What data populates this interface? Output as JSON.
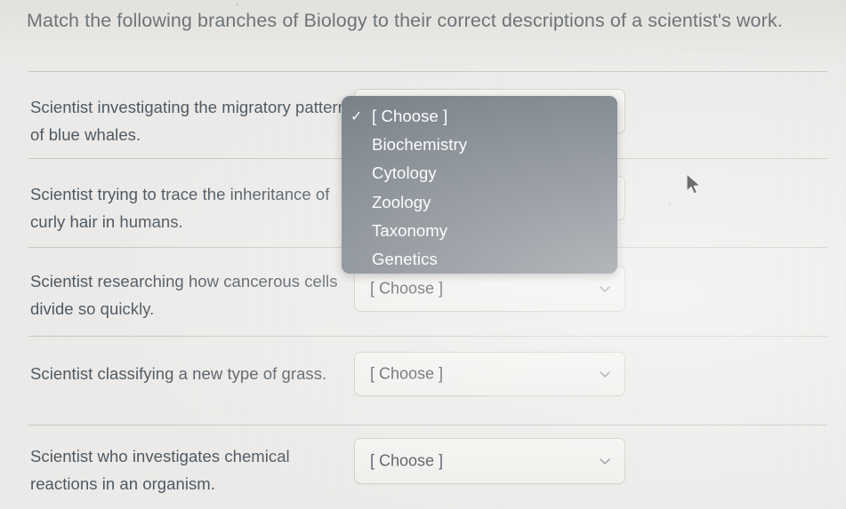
{
  "prompt": {
    "text": "Match the following branches of Biology to their correct descriptions of a scientist's work."
  },
  "colors": {
    "page_background": "#edecea",
    "text": "#4e5862",
    "dropdown_background": "#767e86",
    "dropdown_text": "#ffffff",
    "select_border": "#cfcec9",
    "divider": "#c9c8c4"
  },
  "rows": [
    {
      "id": "row-migratory-whales",
      "description": "Scientist investigating the migratory pattern of blue whales.",
      "select": {
        "value": "[ Choose ]",
        "placeholder": "[ Choose ]",
        "state": "open"
      }
    },
    {
      "id": "row-curly-hair",
      "description": "Scientist trying to trace the inheritance of curly hair in humans.",
      "select": {
        "value": "[ Choose ]",
        "placeholder": "[ Choose ]",
        "state": "closed"
      }
    },
    {
      "id": "row-cancerous-cells",
      "description": "Scientist researching how cancerous cells divide so quickly.",
      "select": {
        "value": "[ Choose ]",
        "placeholder": "[ Choose ]",
        "state": "closed"
      }
    },
    {
      "id": "row-new-grass",
      "description": "Scientist classifying a new type of grass.",
      "select": {
        "value": "[ Choose ]",
        "placeholder": "[ Choose ]",
        "state": "closed"
      }
    },
    {
      "id": "row-chemical-reactions",
      "description": "Scientist who investigates chemical reactions in an organism.",
      "select": {
        "value": "[ Choose ]",
        "placeholder": "[ Choose ]",
        "state": "closed"
      }
    }
  ],
  "dropdown": {
    "open": true,
    "attached_to_row": "row-migratory-whales",
    "selected_index": 0,
    "check_glyph": "✓",
    "options": [
      {
        "label": "[ Choose ]",
        "selected": true
      },
      {
        "label": "Biochemistry",
        "selected": false
      },
      {
        "label": "Cytology",
        "selected": false
      },
      {
        "label": "Zoology",
        "selected": false
      },
      {
        "label": "Taxonomy",
        "selected": false
      },
      {
        "label": "Genetics",
        "selected": false
      }
    ]
  },
  "icons": {
    "chevron": "chevron-down-icon",
    "cursor": "mouse-pointer-icon",
    "check": "check-icon"
  }
}
